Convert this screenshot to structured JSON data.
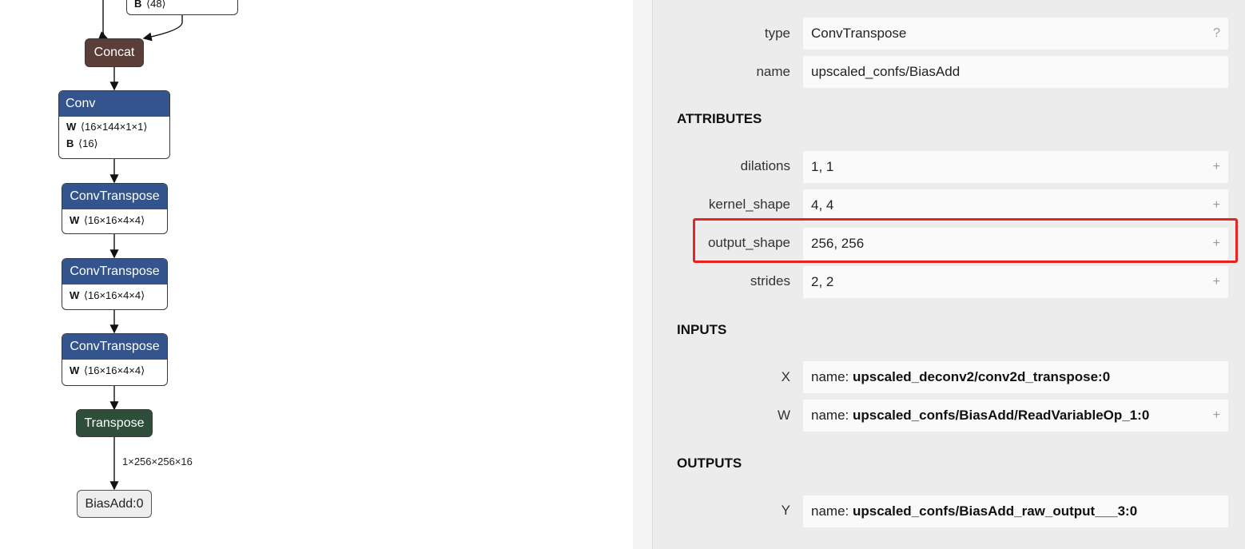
{
  "graph": {
    "truncated_node": {
      "w": "",
      "b": "B",
      "b_shape": "⟨48⟩"
    },
    "concat": {
      "label": "Concat",
      "color": "#5b3e37"
    },
    "conv": {
      "label": "Conv",
      "w": "W",
      "w_shape": "⟨16×144×1×1⟩",
      "b": "B",
      "b_shape": "⟨16⟩",
      "color": "#33548c"
    },
    "convtranspose": [
      {
        "label": "ConvTranspose",
        "w": "W",
        "w_shape": "⟨16×16×4×4⟩"
      },
      {
        "label": "ConvTranspose",
        "w": "W",
        "w_shape": "⟨16×16×4×4⟩"
      },
      {
        "label": "ConvTranspose",
        "w": "W",
        "w_shape": "⟨16×16×4×4⟩"
      }
    ],
    "transpose": {
      "label": "Transpose",
      "color": "#2e4e3a"
    },
    "edge_label": "1×256×256×16",
    "output": {
      "label": "BiasAdd:0"
    }
  },
  "panel": {
    "type_label": "type",
    "type_value": "ConvTranspose",
    "type_help": "?",
    "name_label": "name",
    "name_value": "upscaled_confs/BiasAdd",
    "attributes_title": "ATTRIBUTES",
    "attributes": [
      {
        "label": "dilations",
        "value": "1, 1",
        "btn": "+"
      },
      {
        "label": "kernel_shape",
        "value": "4, 4",
        "btn": "+"
      },
      {
        "label": "output_shape",
        "value": "256, 256",
        "btn": "+"
      },
      {
        "label": "strides",
        "value": "2, 2",
        "btn": "+"
      }
    ],
    "inputs_title": "INPUTS",
    "inputs": [
      {
        "label": "X",
        "prefix": "name: ",
        "value": "upscaled_deconv2/conv2d_transpose:0",
        "btn": ""
      },
      {
        "label": "W",
        "prefix": "name: ",
        "value": "upscaled_confs/BiasAdd/ReadVariableOp_1:0",
        "btn": "+"
      }
    ],
    "outputs_title": "OUTPUTS",
    "outputs": [
      {
        "label": "Y",
        "prefix": "name: ",
        "value": "upscaled_confs/BiasAdd_raw_output___3:0",
        "btn": ""
      }
    ],
    "highlight_color": "#e8231f"
  }
}
